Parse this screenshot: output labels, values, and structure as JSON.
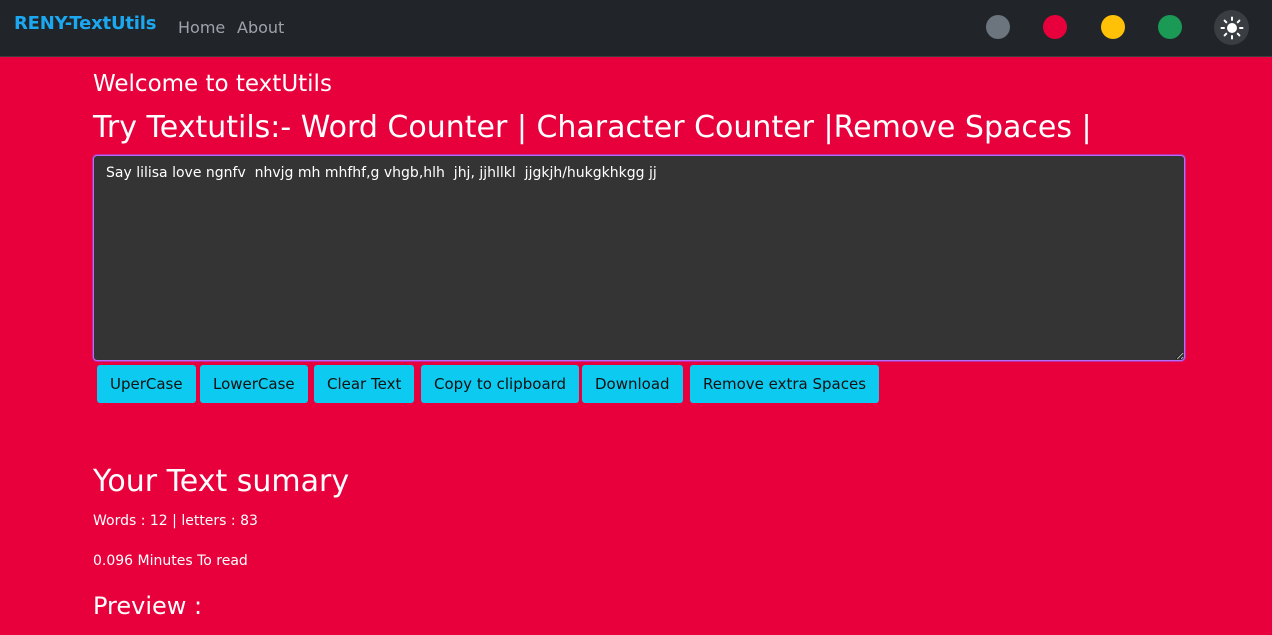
{
  "navbar": {
    "brand": "RENY-TextUtils",
    "links": [
      "Home",
      "About"
    ],
    "theme_swatches": [
      {
        "name": "gray",
        "color": "#6c757d"
      },
      {
        "name": "red",
        "color": "#e8003c"
      },
      {
        "name": "yellow",
        "color": "#ffc107"
      },
      {
        "name": "green",
        "color": "#1a9a55"
      }
    ],
    "theme_toggle_icon": "sun-icon"
  },
  "main": {
    "welcome": "Welcome to textUtils",
    "heading": "Try Textutils:- Word Counter | Character Counter |Remove Spaces |",
    "textarea_value": "Say lilisa love ngnfv  nhvjg mh mhfhf,g vhgb,hlh  jhj, jjhllkl  jjgkjh/hukgkhkgg jj",
    "buttons": [
      "UperCase",
      "LowerCase",
      "Clear Text",
      "Copy to clipboard",
      "Download",
      "Remove extra Spaces"
    ]
  },
  "summary": {
    "title": "Your Text sumary",
    "stats": "Words : 12 | letters : 83",
    "read_time": "0.096 Minutes To read",
    "preview_title": "Preview :"
  },
  "colors": {
    "page_bg": "#e8003c",
    "navbar_bg": "#212529",
    "brand": "#1ba8f0",
    "button": "#0dcaf0",
    "textarea_bg": "#343434"
  }
}
